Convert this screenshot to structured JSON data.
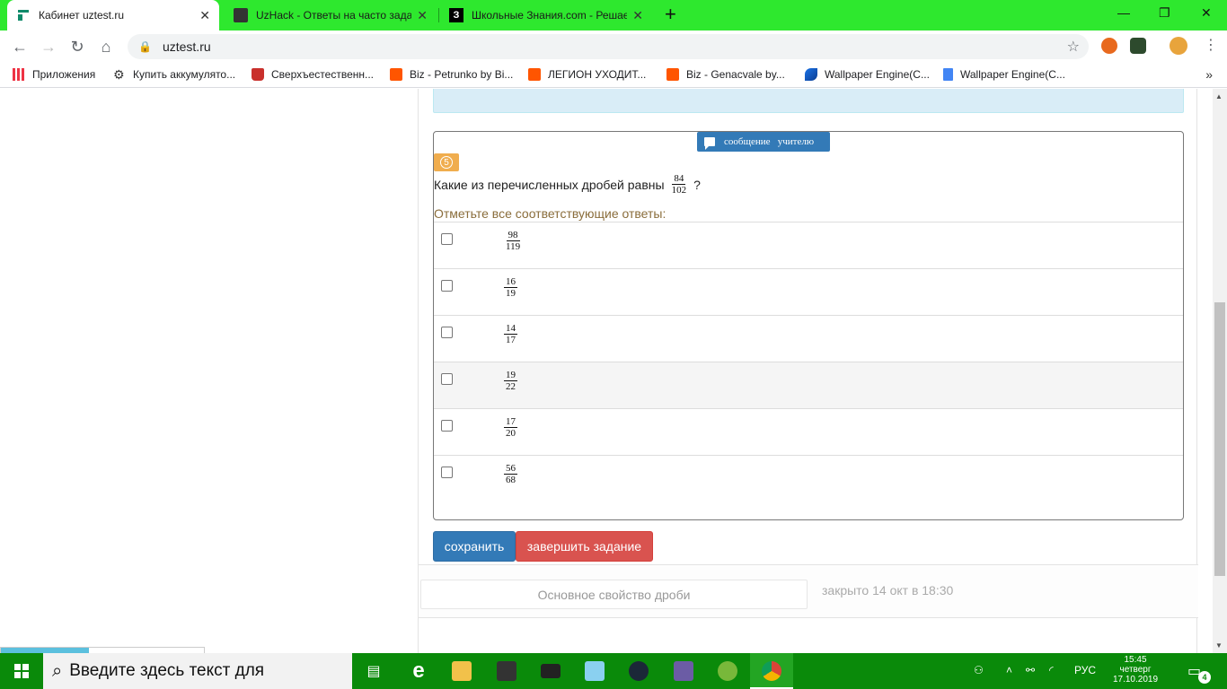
{
  "browser": {
    "tabs": [
      {
        "title": "Кабинет uztest.ru",
        "active": true,
        "icon": "uztest-favicon"
      },
      {
        "title": "UzHack - Ответы на часто зада",
        "active": false,
        "icon": "uzhack-favicon"
      },
      {
        "title": "Школьные Знания.com - Решае",
        "active": false,
        "icon": "znania-favicon"
      }
    ],
    "new_tab": "+",
    "window_controls": {
      "minimize": "—",
      "restore": "❐",
      "close": "✕"
    },
    "url": "uztest.ru",
    "bookmarks": [
      {
        "label": "Приложения",
        "icon": "apps-grid-icon"
      },
      {
        "label": "Купить аккумулято...",
        "icon": "gear-icon"
      },
      {
        "label": "Сверхъестественн...",
        "icon": "popcorn-icon"
      },
      {
        "label": "Biz - Petrunko by Bi...",
        "icon": "soundcloud-icon"
      },
      {
        "label": "ЛЕГИОН УХОДИТ...",
        "icon": "soundcloud-icon"
      },
      {
        "label": "Biz - Genacvale by...",
        "icon": "soundcloud-icon"
      },
      {
        "label": "Wallpaper Engine(C...",
        "icon": "wallpaper-engine-icon"
      },
      {
        "label": "Wallpaper Engine(C...",
        "icon": "document-icon"
      }
    ],
    "bookmarks_more": "»"
  },
  "task": {
    "message_button": "сообщение   учителю",
    "question_number": "5",
    "question_text": "Какие из перечисленных дробей равны",
    "question_fraction": {
      "num": "84",
      "den": "102"
    },
    "question_mark": "?",
    "hint": "Отметьте все соответствующие ответы:",
    "options": [
      {
        "num": "98",
        "den": "119",
        "checked": false
      },
      {
        "num": "16",
        "den": "19",
        "checked": false
      },
      {
        "num": "14",
        "den": "17",
        "checked": false
      },
      {
        "num": "19",
        "den": "22",
        "checked": false
      },
      {
        "num": "17",
        "den": "20",
        "checked": false
      },
      {
        "num": "56",
        "den": "68",
        "checked": false
      }
    ],
    "save_label": "сохранить",
    "finish_label": "завершить задание"
  },
  "footer": {
    "topic": "Основное свойство дроби",
    "closed": "закрыто 14 окт в 18:30"
  },
  "taskbar": {
    "search_placeholder": "Введите здесь текст для",
    "language": "РУС",
    "time": "15:45",
    "weekday": "четверг",
    "date": "17.10.2019",
    "notifications": "4"
  },
  "colors": {
    "tabstrip": "#2ee82e",
    "taskbar": "#0a8a0a",
    "primary": "#337ab7",
    "danger": "#d9534f",
    "warning": "#f0ad4e"
  }
}
